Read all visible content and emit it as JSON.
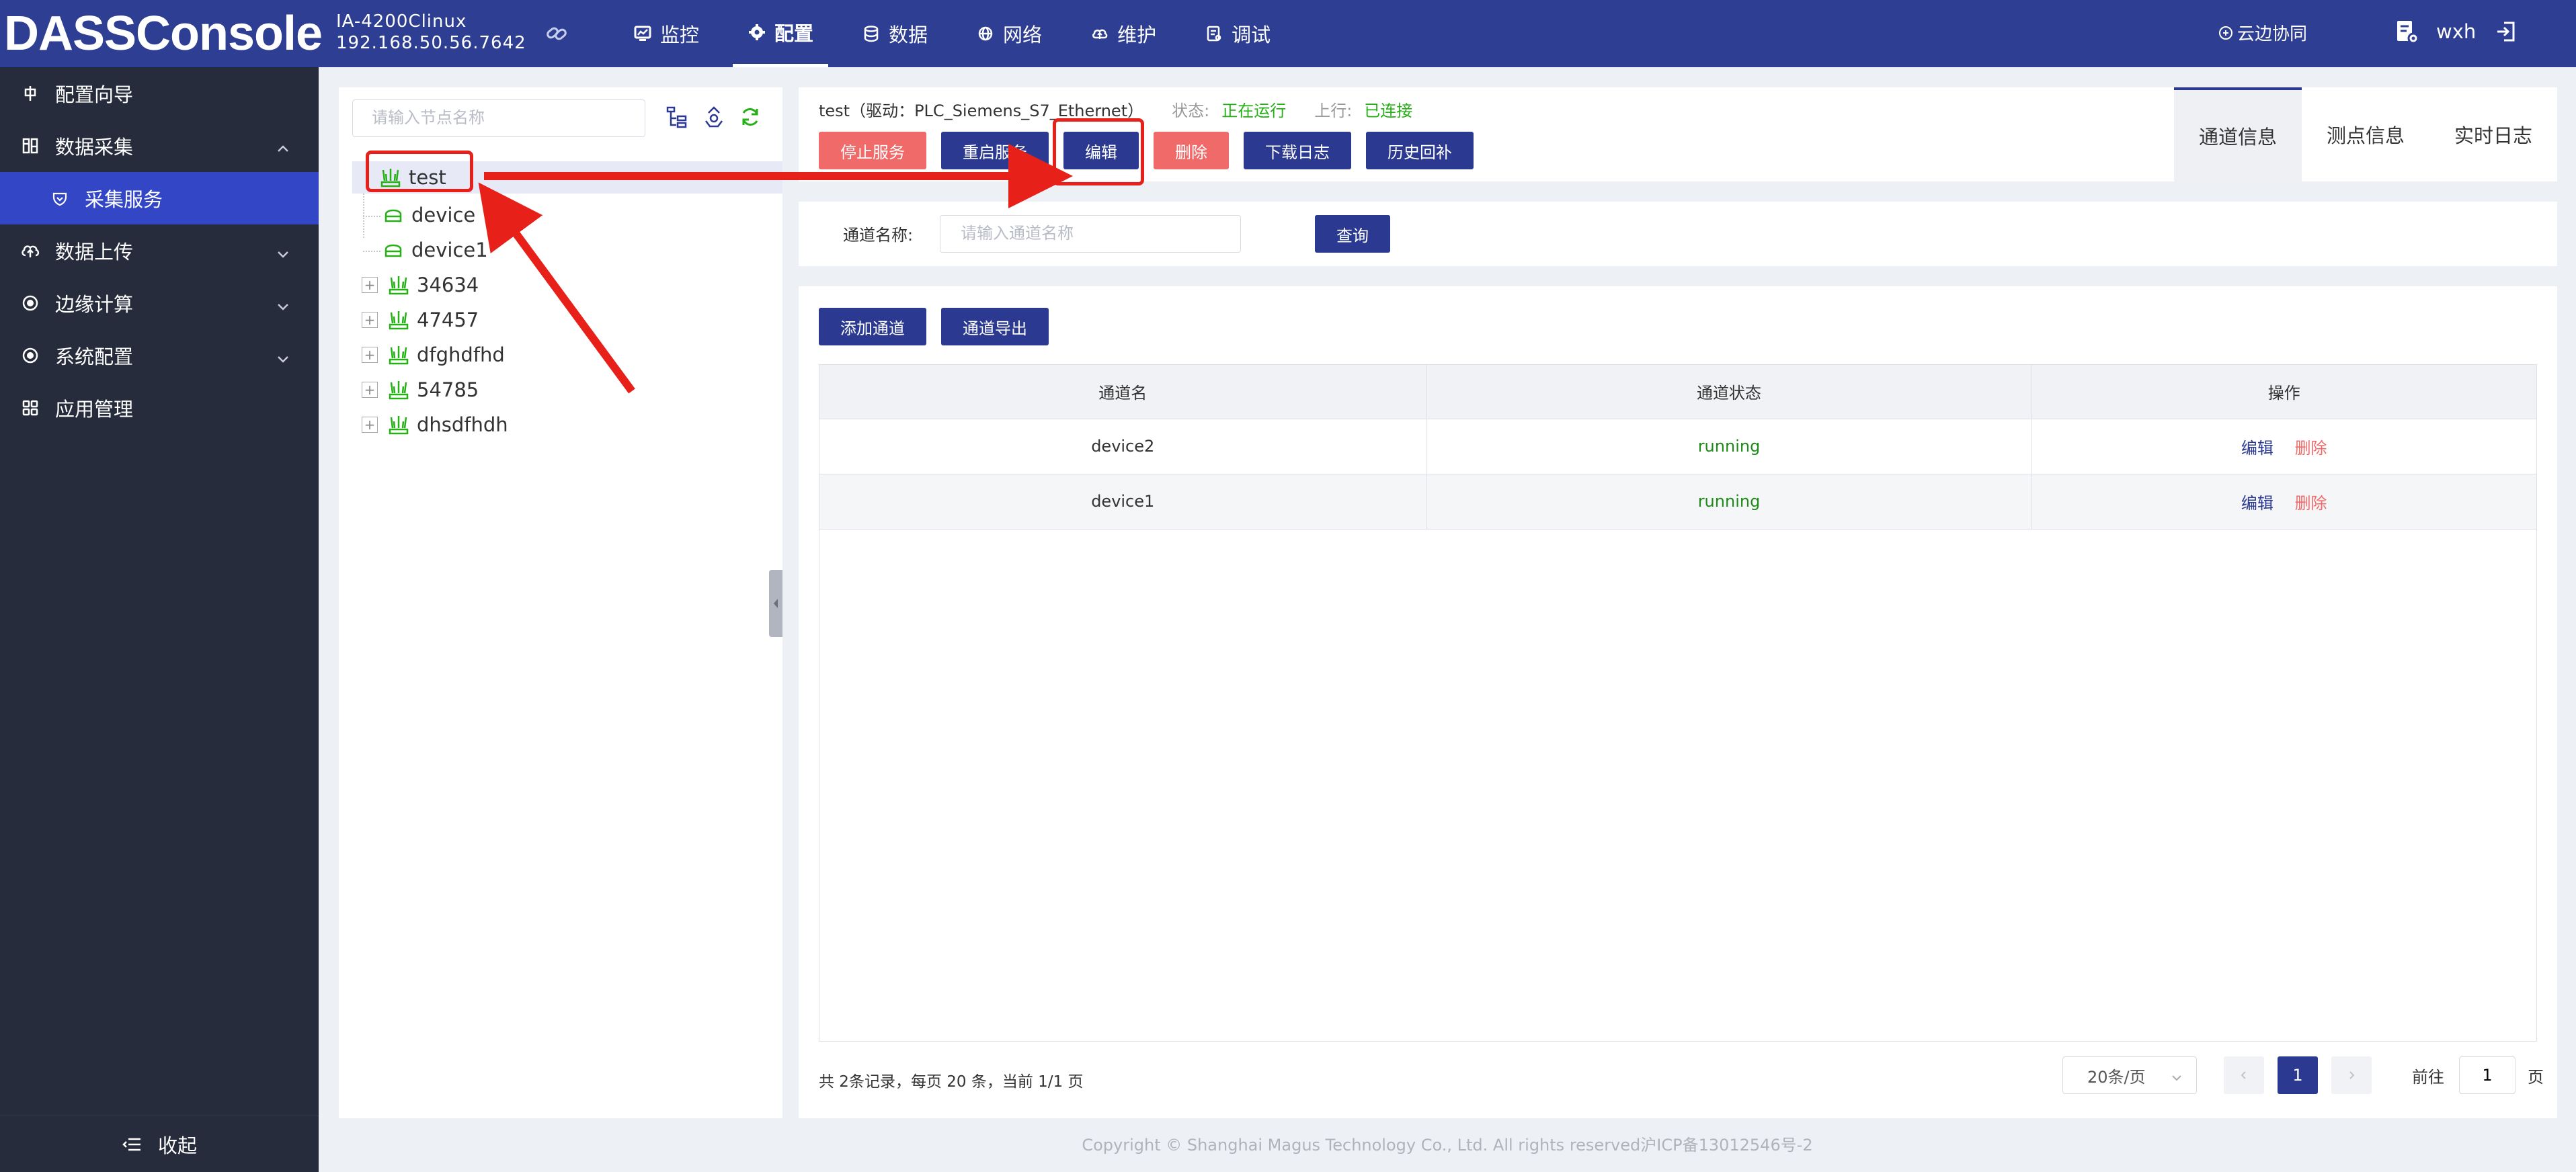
{
  "app": {
    "logo": "DASSConsole",
    "device_model": "IA-4200Clinux",
    "device_ip": "192.168.50.56.7642"
  },
  "nav": [
    {
      "label": "监控",
      "icon": "monitor-icon"
    },
    {
      "label": "配置",
      "icon": "config-icon",
      "active": true
    },
    {
      "label": "数据",
      "icon": "database-icon"
    },
    {
      "label": "网络",
      "icon": "network-icon"
    },
    {
      "label": "维护",
      "icon": "cloud-icon"
    },
    {
      "label": "调试",
      "icon": "debug-icon"
    }
  ],
  "header_right": {
    "cloud_label": "云边协同",
    "user_name": "wxh"
  },
  "sidebar": {
    "items": [
      {
        "label": "配置向导"
      },
      {
        "label": "数据采集"
      },
      {
        "label": "采集服务"
      },
      {
        "label": "数据上传"
      },
      {
        "label": "边缘计算"
      },
      {
        "label": "系统配置"
      },
      {
        "label": "应用管理"
      }
    ],
    "collapse_label": "收起"
  },
  "tree": {
    "search_placeholder": "请输入节点名称",
    "nodes": [
      {
        "label": "test"
      },
      {
        "label": "device"
      },
      {
        "label": "device1"
      },
      {
        "label": "34634"
      },
      {
        "label": "47457"
      },
      {
        "label": "dfghdfhd"
      },
      {
        "label": "54785"
      },
      {
        "label": "dhsdfhdh"
      }
    ]
  },
  "service": {
    "name_line": "test（驱动：PLC_Siemens_S7_Ethernet）",
    "status_label": "状态:",
    "status_value": "正在运行",
    "uplink_label": "上行:",
    "uplink_value": "已连接",
    "buttons": {
      "stop": "停止服务",
      "restart": "重启服务",
      "edit": "编辑",
      "delete": "删除",
      "download_log": "下载日志",
      "history": "历史回补"
    }
  },
  "tabs": [
    {
      "label": "通道信息",
      "active": true
    },
    {
      "label": "测点信息"
    },
    {
      "label": "实时日志"
    }
  ],
  "query": {
    "label": "通道名称:",
    "placeholder": "请输入通道名称",
    "button": "查询"
  },
  "channels": {
    "add_button": "添加通道",
    "export_button": "通道导出",
    "columns": [
      "通道名",
      "通道状态",
      "操作"
    ],
    "rows": [
      {
        "name": "device2",
        "status": "running",
        "edit": "编辑",
        "delete": "删除"
      },
      {
        "name": "device1",
        "status": "running",
        "edit": "编辑",
        "delete": "删除"
      }
    ]
  },
  "pagination": {
    "info": "共 2条记录，每页 20 条，当前 1/1 页",
    "page_size": "20条/页",
    "current_page": "1",
    "goto_label": "前往",
    "goto_value": "1",
    "page_suffix": "页"
  },
  "footer": "Copyright © Shanghai Magus Technology Co., Ltd. All rights reserved沪ICP备13012546号-2",
  "colors": {
    "header_bg": "#2e3f93",
    "sidebar_bg": "#262c3c",
    "sidebar_active": "#3347c6",
    "primary": "#2b3990",
    "danger": "#f06a6a",
    "success": "#25b016",
    "annotation": "#e8201a"
  }
}
